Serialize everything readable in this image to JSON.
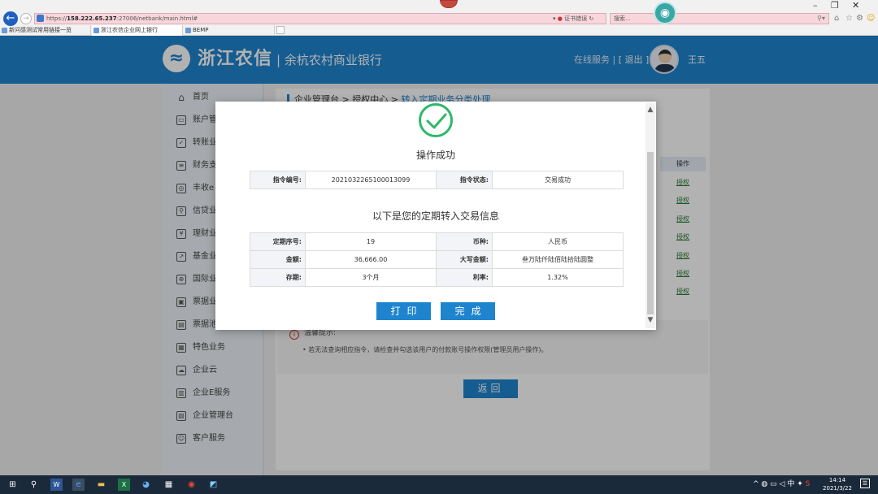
{
  "browser": {
    "url_prefix": "https://",
    "url_host": "158.222.65.237",
    "url_rest": ":27006/netbank/main.html#",
    "cert_label": "证书错误",
    "search_placeholder": "搜索...",
    "tabs": [
      {
        "label": "新问感测试常用链接一览"
      },
      {
        "label": "浙江农信企业网上银行"
      },
      {
        "label": "BEMP"
      }
    ]
  },
  "header": {
    "brand": "浙江农信",
    "bank_name": "| 余杭农村商业银行",
    "online_service": "在线服务 |",
    "logout": "[ 退出 ]",
    "user_name": "王五"
  },
  "sidebar": {
    "items": [
      {
        "label": "首页",
        "icon": "⌂"
      },
      {
        "label": "账户管",
        "icon": "▭"
      },
      {
        "label": "转账业",
        "icon": "✓"
      },
      {
        "label": "财务支",
        "icon": "≡"
      },
      {
        "label": "丰收e",
        "icon": "◎"
      },
      {
        "label": "信贷业",
        "icon": "⚲"
      },
      {
        "label": "理财业",
        "icon": "¥"
      },
      {
        "label": "基金业",
        "icon": "↗"
      },
      {
        "label": "国际业",
        "icon": "⊕"
      },
      {
        "label": "票据业",
        "icon": "▣"
      },
      {
        "label": "票据池",
        "icon": "▤"
      },
      {
        "label": "特色业务",
        "icon": "▦"
      },
      {
        "label": "企业云",
        "icon": "☁"
      },
      {
        "label": "企业E服务",
        "icon": "▥"
      },
      {
        "label": "企业管理台",
        "icon": "▧"
      },
      {
        "label": "客户服务",
        "icon": "☺"
      }
    ]
  },
  "breadcrumb": {
    "p1": "企业管理台",
    "sep1": " > ",
    "p2": "授权中心",
    "sep2": " > ",
    "current": "转入定期业务分类处理"
  },
  "background_table": {
    "op_header": "操作",
    "op_links": [
      "授权",
      "授权",
      "授权",
      "授权",
      "授权",
      "授权",
      "授权"
    ]
  },
  "tips": {
    "title": "温馨提示:",
    "text": "•  若无法查询相应指令，请检查并勾选该用户的付款账号操作权限(管理员用户操作)。"
  },
  "return_button": "返回",
  "modal": {
    "success_title": "操作成功",
    "instr_no_label": "指令编号:",
    "instr_no": "2021032265100013099",
    "instr_status_label": "指令状态:",
    "instr_status": "交易成功",
    "section_title": "以下是您的定期转入交易信息",
    "deposit_no_label": "定期序号:",
    "deposit_no": "19",
    "currency_label": "币种:",
    "currency": "人民币",
    "amount_label": "金额:",
    "amount": "36,666.00",
    "amount_upper_label": "大写金额:",
    "amount_upper": "叁万陆仟陆佰陆拾陆圆整",
    "term_label": "存期:",
    "term": "3个月",
    "rate_label": "利率:",
    "rate": "1.32%",
    "print_button": "打印",
    "done_button": "完成"
  },
  "taskbar": {
    "time": "14:14",
    "date": "2021/3/22",
    "ime": "中"
  },
  "colors": {
    "header_blue": "#1f84ce",
    "success_green": "#2fb76a"
  }
}
